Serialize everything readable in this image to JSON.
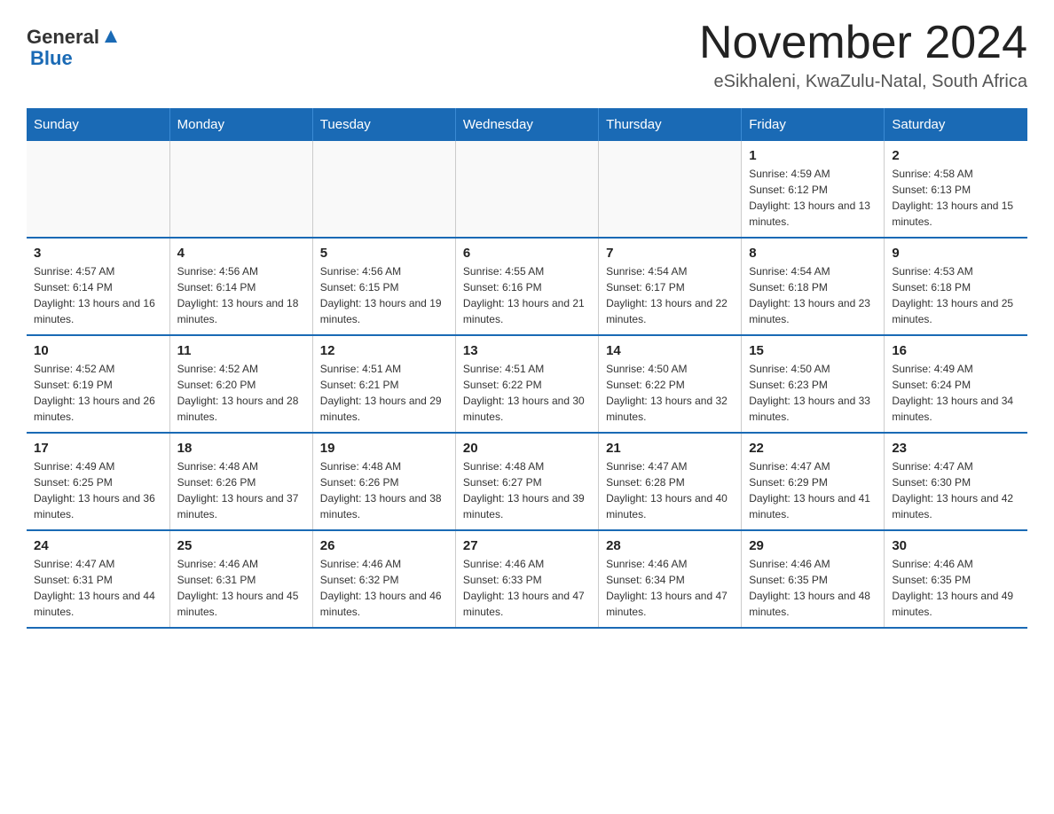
{
  "header": {
    "logo_general": "General",
    "logo_blue": "Blue",
    "title": "November 2024",
    "subtitle": "eSikhaleni, KwaZulu-Natal, South Africa"
  },
  "weekdays": [
    "Sunday",
    "Monday",
    "Tuesday",
    "Wednesday",
    "Thursday",
    "Friday",
    "Saturday"
  ],
  "weeks": [
    [
      {
        "day": "",
        "info": ""
      },
      {
        "day": "",
        "info": ""
      },
      {
        "day": "",
        "info": ""
      },
      {
        "day": "",
        "info": ""
      },
      {
        "day": "",
        "info": ""
      },
      {
        "day": "1",
        "info": "Sunrise: 4:59 AM\nSunset: 6:12 PM\nDaylight: 13 hours and 13 minutes."
      },
      {
        "day": "2",
        "info": "Sunrise: 4:58 AM\nSunset: 6:13 PM\nDaylight: 13 hours and 15 minutes."
      }
    ],
    [
      {
        "day": "3",
        "info": "Sunrise: 4:57 AM\nSunset: 6:14 PM\nDaylight: 13 hours and 16 minutes."
      },
      {
        "day": "4",
        "info": "Sunrise: 4:56 AM\nSunset: 6:14 PM\nDaylight: 13 hours and 18 minutes."
      },
      {
        "day": "5",
        "info": "Sunrise: 4:56 AM\nSunset: 6:15 PM\nDaylight: 13 hours and 19 minutes."
      },
      {
        "day": "6",
        "info": "Sunrise: 4:55 AM\nSunset: 6:16 PM\nDaylight: 13 hours and 21 minutes."
      },
      {
        "day": "7",
        "info": "Sunrise: 4:54 AM\nSunset: 6:17 PM\nDaylight: 13 hours and 22 minutes."
      },
      {
        "day": "8",
        "info": "Sunrise: 4:54 AM\nSunset: 6:18 PM\nDaylight: 13 hours and 23 minutes."
      },
      {
        "day": "9",
        "info": "Sunrise: 4:53 AM\nSunset: 6:18 PM\nDaylight: 13 hours and 25 minutes."
      }
    ],
    [
      {
        "day": "10",
        "info": "Sunrise: 4:52 AM\nSunset: 6:19 PM\nDaylight: 13 hours and 26 minutes."
      },
      {
        "day": "11",
        "info": "Sunrise: 4:52 AM\nSunset: 6:20 PM\nDaylight: 13 hours and 28 minutes."
      },
      {
        "day": "12",
        "info": "Sunrise: 4:51 AM\nSunset: 6:21 PM\nDaylight: 13 hours and 29 minutes."
      },
      {
        "day": "13",
        "info": "Sunrise: 4:51 AM\nSunset: 6:22 PM\nDaylight: 13 hours and 30 minutes."
      },
      {
        "day": "14",
        "info": "Sunrise: 4:50 AM\nSunset: 6:22 PM\nDaylight: 13 hours and 32 minutes."
      },
      {
        "day": "15",
        "info": "Sunrise: 4:50 AM\nSunset: 6:23 PM\nDaylight: 13 hours and 33 minutes."
      },
      {
        "day": "16",
        "info": "Sunrise: 4:49 AM\nSunset: 6:24 PM\nDaylight: 13 hours and 34 minutes."
      }
    ],
    [
      {
        "day": "17",
        "info": "Sunrise: 4:49 AM\nSunset: 6:25 PM\nDaylight: 13 hours and 36 minutes."
      },
      {
        "day": "18",
        "info": "Sunrise: 4:48 AM\nSunset: 6:26 PM\nDaylight: 13 hours and 37 minutes."
      },
      {
        "day": "19",
        "info": "Sunrise: 4:48 AM\nSunset: 6:26 PM\nDaylight: 13 hours and 38 minutes."
      },
      {
        "day": "20",
        "info": "Sunrise: 4:48 AM\nSunset: 6:27 PM\nDaylight: 13 hours and 39 minutes."
      },
      {
        "day": "21",
        "info": "Sunrise: 4:47 AM\nSunset: 6:28 PM\nDaylight: 13 hours and 40 minutes."
      },
      {
        "day": "22",
        "info": "Sunrise: 4:47 AM\nSunset: 6:29 PM\nDaylight: 13 hours and 41 minutes."
      },
      {
        "day": "23",
        "info": "Sunrise: 4:47 AM\nSunset: 6:30 PM\nDaylight: 13 hours and 42 minutes."
      }
    ],
    [
      {
        "day": "24",
        "info": "Sunrise: 4:47 AM\nSunset: 6:31 PM\nDaylight: 13 hours and 44 minutes."
      },
      {
        "day": "25",
        "info": "Sunrise: 4:46 AM\nSunset: 6:31 PM\nDaylight: 13 hours and 45 minutes."
      },
      {
        "day": "26",
        "info": "Sunrise: 4:46 AM\nSunset: 6:32 PM\nDaylight: 13 hours and 46 minutes."
      },
      {
        "day": "27",
        "info": "Sunrise: 4:46 AM\nSunset: 6:33 PM\nDaylight: 13 hours and 47 minutes."
      },
      {
        "day": "28",
        "info": "Sunrise: 4:46 AM\nSunset: 6:34 PM\nDaylight: 13 hours and 47 minutes."
      },
      {
        "day": "29",
        "info": "Sunrise: 4:46 AM\nSunset: 6:35 PM\nDaylight: 13 hours and 48 minutes."
      },
      {
        "day": "30",
        "info": "Sunrise: 4:46 AM\nSunset: 6:35 PM\nDaylight: 13 hours and 49 minutes."
      }
    ]
  ]
}
